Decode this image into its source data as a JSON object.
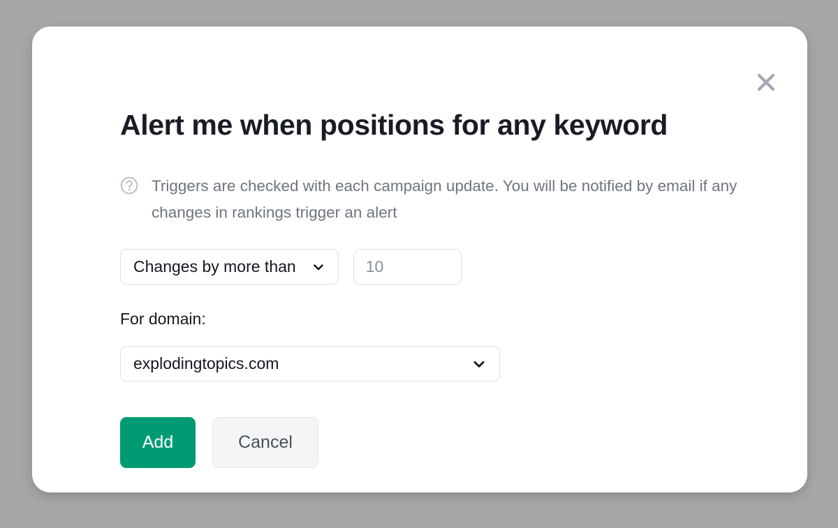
{
  "modal": {
    "title": "Alert me when positions for any keyword",
    "close_icon": "close-icon",
    "description": {
      "icon": "question-circle-icon",
      "text": "Triggers are checked with each campaign update. You will be notified by email if any changes in rankings trigger an alert"
    },
    "condition": {
      "select_value": "Changes by more than",
      "select_chevron_icon": "chevron-down-icon",
      "threshold_value": "10",
      "threshold_placeholder": "10"
    },
    "domain": {
      "label": "For domain:",
      "select_value": "explodingtopics.com",
      "select_chevron_icon": "chevron-down-icon"
    },
    "actions": {
      "submit_label": "Add",
      "cancel_label": "Cancel"
    },
    "colors": {
      "accent_green": "#009b72",
      "backdrop": "#a6a7a9",
      "title_text": "#191c25",
      "muted_text": "#6e757e",
      "border": "#dcdfe3",
      "cancel_bg": "#f4f5f7"
    }
  }
}
